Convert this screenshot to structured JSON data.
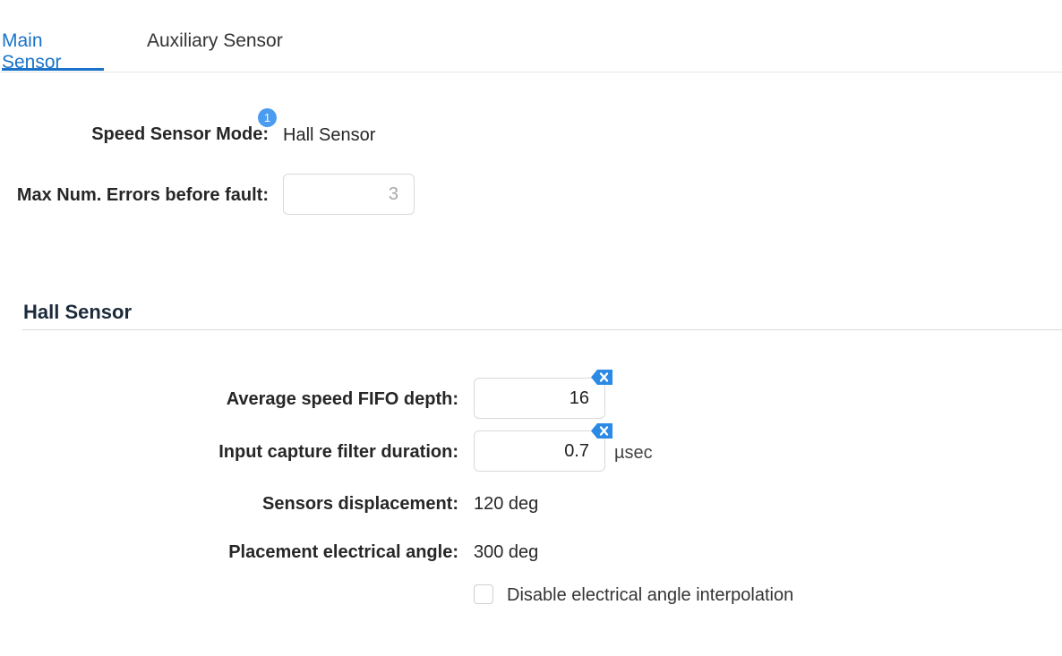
{
  "tabs": {
    "main": "Main Sensor",
    "auxiliary": "Auxiliary Sensor"
  },
  "main_sensor": {
    "mode_label": "Speed Sensor Mode:",
    "mode_value": "Hall Sensor",
    "info_badge": "1",
    "max_errors_label": "Max Num. Errors before fault:",
    "max_errors_value": "3"
  },
  "hall_section": {
    "title": "Hall Sensor",
    "fifo_label": "Average speed FIFO depth:",
    "fifo_value": "16",
    "filter_label": "Input capture filter duration:",
    "filter_value": "0.7",
    "filter_unit": "µsec",
    "displacement_label": "Sensors displacement:",
    "displacement_value": "120 deg",
    "angle_label": "Placement electrical angle:",
    "angle_value": "300 deg",
    "interpolation_checkbox_label": "Disable electrical angle interpolation",
    "interpolation_checked": false
  },
  "colors": {
    "accent": "#1a73c9",
    "badge": "#4a9cf0",
    "clear_icon": "#2b8ae6"
  },
  "icons": {
    "clear": "backspace-clear-icon"
  }
}
